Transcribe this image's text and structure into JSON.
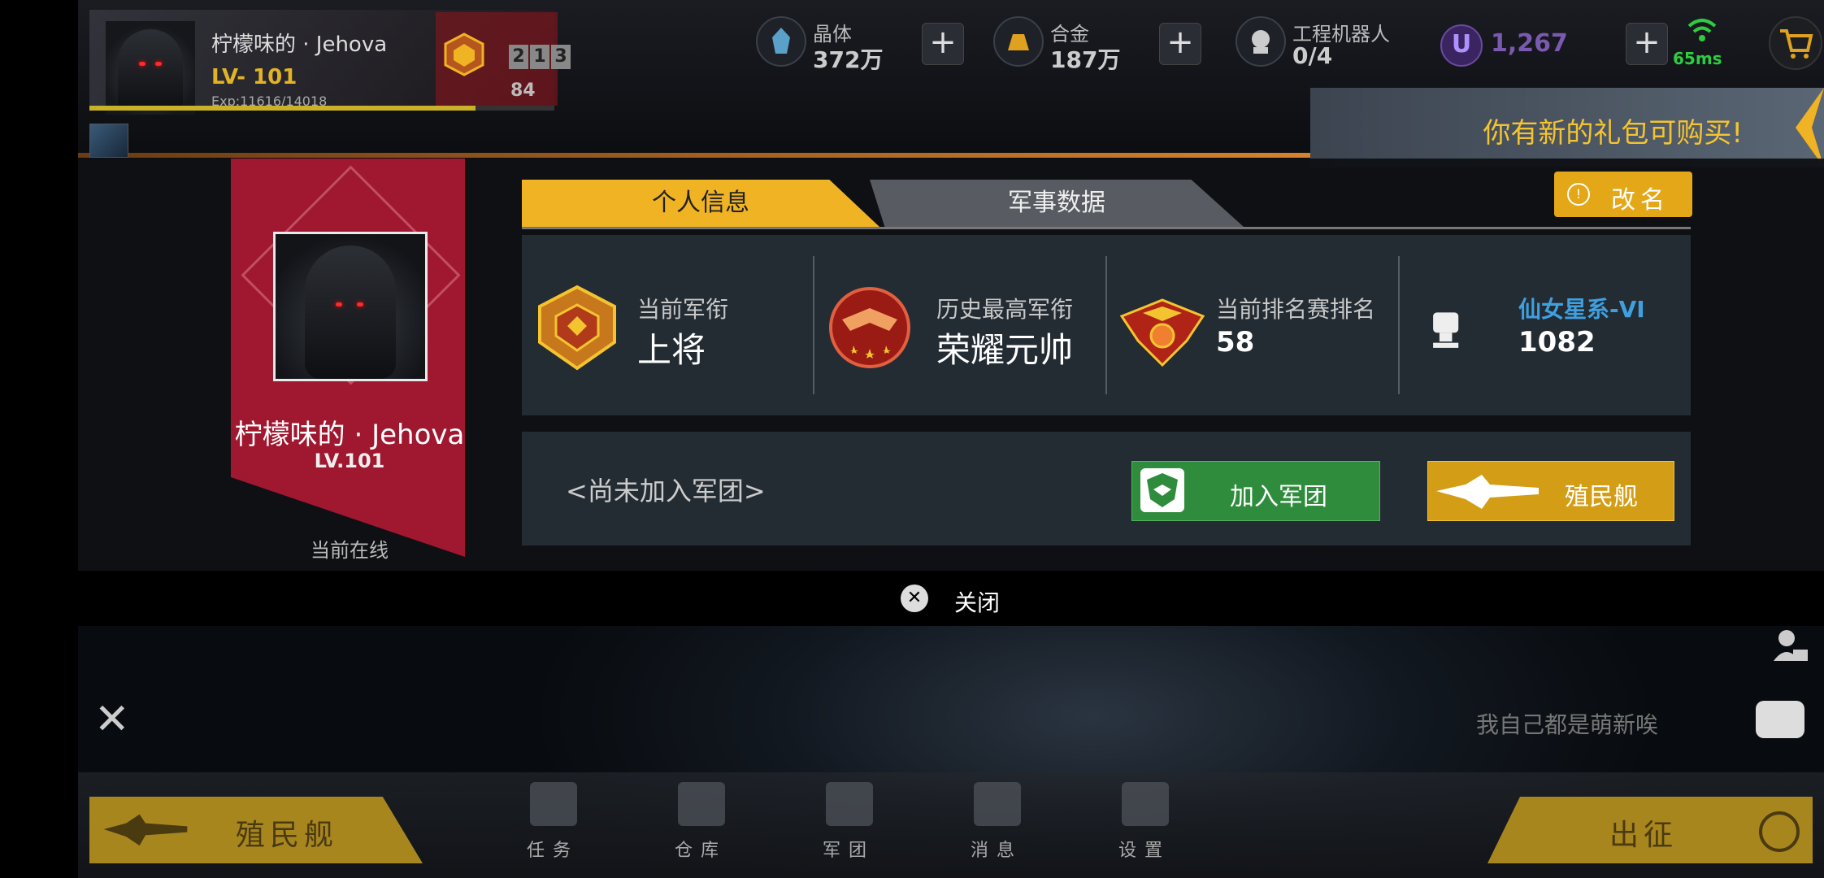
{
  "header": {
    "player_name": "柠檬味的 · Jehova",
    "level": "LV- 101",
    "exp": "Exp:11616/14018",
    "exp_fraction": 0.83,
    "rank_digits": [
      "2",
      "1",
      "3"
    ],
    "rank_number": "84",
    "resources": [
      {
        "icon": "crystal-icon",
        "label": "晶体",
        "value": "372万"
      },
      {
        "icon": "alloy-icon",
        "label": "合金",
        "value": "187万"
      },
      {
        "icon": "robot-icon",
        "label": "工程机器人",
        "value": "0/4"
      }
    ],
    "currency_symbol": "U",
    "currency_value": "1,267",
    "ping": "65ms",
    "plus_symbol": "+"
  },
  "banner": {
    "text": "你有新的礼包可购买!"
  },
  "profile": {
    "name": "柠檬味的 · Jehova",
    "level": "LV.101",
    "status": "当前在线"
  },
  "tabs": [
    {
      "label": "个人信息",
      "active": true
    },
    {
      "label": "军事数据",
      "active": false
    }
  ],
  "rename_label": "改名",
  "stats": {
    "current_rank_label": "当前军衔",
    "current_rank_value": "上将",
    "highest_rank_label": "历史最高军衔",
    "highest_rank_value": "荣耀元帅",
    "ranking_label": "当前排名赛排名",
    "ranking_value": "58",
    "galaxy_label": "仙女星系-VI",
    "galaxy_value": "1082"
  },
  "legion": {
    "status_text": "<尚未加入军团>",
    "join_label": "加入军团",
    "ship_label": "殖民舰"
  },
  "close_label": "关闭",
  "chat": {
    "placeholder_text": "我自己都是萌新唉"
  },
  "bottom_nav": {
    "colony_label": "殖民舰",
    "expedition_label": "出征",
    "items": [
      {
        "icon": "task-icon",
        "label": "任务"
      },
      {
        "icon": "warehouse-icon",
        "label": "仓库"
      },
      {
        "icon": "legion-icon",
        "label": "军团"
      },
      {
        "icon": "message-icon",
        "label": "消息"
      },
      {
        "icon": "settings-icon",
        "label": "设置"
      }
    ]
  },
  "colors": {
    "accent": "#f0b323",
    "ribbon": "#a01830",
    "join": "#2f8c3d",
    "galaxy": "#3fa0e0",
    "ping": "#2ecc40"
  }
}
